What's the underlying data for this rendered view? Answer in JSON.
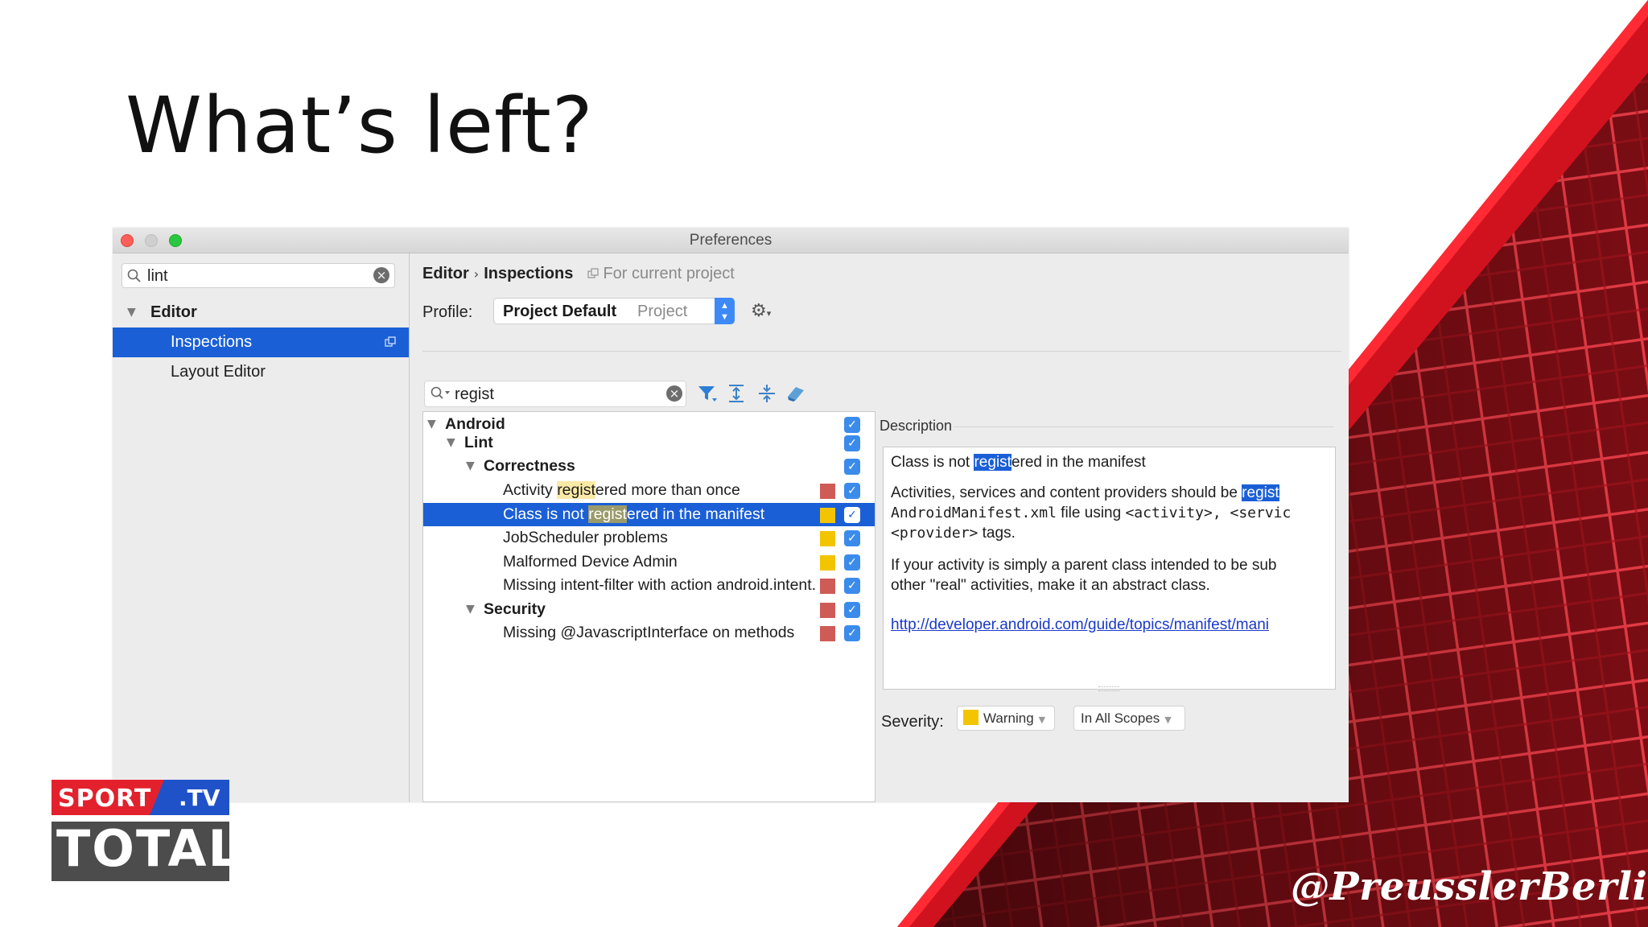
{
  "slide": {
    "title": "What’s left?",
    "handle": "@PreusslerBerlin"
  },
  "logo": {
    "top_text": "SPORT",
    "top_suffix": ".TV",
    "bottom_text": "TOTAL"
  },
  "window": {
    "title": "Preferences"
  },
  "sidebar": {
    "search_value": "lint",
    "items": [
      {
        "label": "Editor"
      },
      {
        "label": "Inspections"
      },
      {
        "label": "Layout Editor"
      }
    ]
  },
  "breadcrumb": {
    "part1": "Editor",
    "separator": "›",
    "part2": "Inspections",
    "hint": "For current project"
  },
  "profile": {
    "label": "Profile:",
    "name": "Project Default",
    "scope": "Project"
  },
  "filter": {
    "value": "regist"
  },
  "inspections": {
    "rows": [
      {
        "label": "Android",
        "level": 0,
        "bold": true,
        "severity": "",
        "checked": true
      },
      {
        "label": "Lint",
        "level": 1,
        "bold": true,
        "severity": "",
        "checked": true
      },
      {
        "label": "Correctness",
        "level": 2,
        "bold": true,
        "severity": "",
        "checked": true
      },
      {
        "pre": "Activity ",
        "match": "regist",
        "post": "ered more than once",
        "level": 3,
        "severity": "error",
        "checked": true
      },
      {
        "pre": "Class is not ",
        "match": "regist",
        "post": "ered in the manifest",
        "level": 3,
        "severity": "warning",
        "checked": true,
        "selected": true
      },
      {
        "label": "JobScheduler problems",
        "level": 3,
        "severity": "warning",
        "checked": true
      },
      {
        "label": "Malformed Device Admin",
        "level": 3,
        "severity": "warning",
        "checked": true
      },
      {
        "label": "Missing intent-filter with action android.intent.action.VIEW",
        "level": 3,
        "severity": "error",
        "checked": true
      },
      {
        "label": "Security",
        "level": 2,
        "bold": true,
        "severity": "error",
        "checked": true
      },
      {
        "label": "Missing @JavascriptInterface on methods",
        "level": 3,
        "severity": "error",
        "checked": true
      }
    ]
  },
  "description": {
    "label": "Description",
    "l1_pre": "Class is not ",
    "l1_match": "regist",
    "l1_post": "ered in the manifest",
    "l2_pre": "Activities, services and content providers should be ",
    "l2_match": "regist",
    "l3_mono1": "AndroidManifest.xml",
    "l3_text": " file using ",
    "l3_mono2": "<activity>, <servic",
    "l4_mono": "<provider>",
    "l4_text": " tags.",
    "l5": "If your activity is simply a parent class intended to be sub",
    "l6": "other \"real\" activities, make it an abstract class.",
    "link": "http://developer.android.com/guide/topics/manifest/mani"
  },
  "severity": {
    "label": "Severity:",
    "value": "Warning",
    "scope": "In All Scopes"
  },
  "colors": {
    "selection": "#1a5fd6",
    "error": "#cf5b56",
    "warning": "#f2c500",
    "accent_red": "#d0121e"
  }
}
